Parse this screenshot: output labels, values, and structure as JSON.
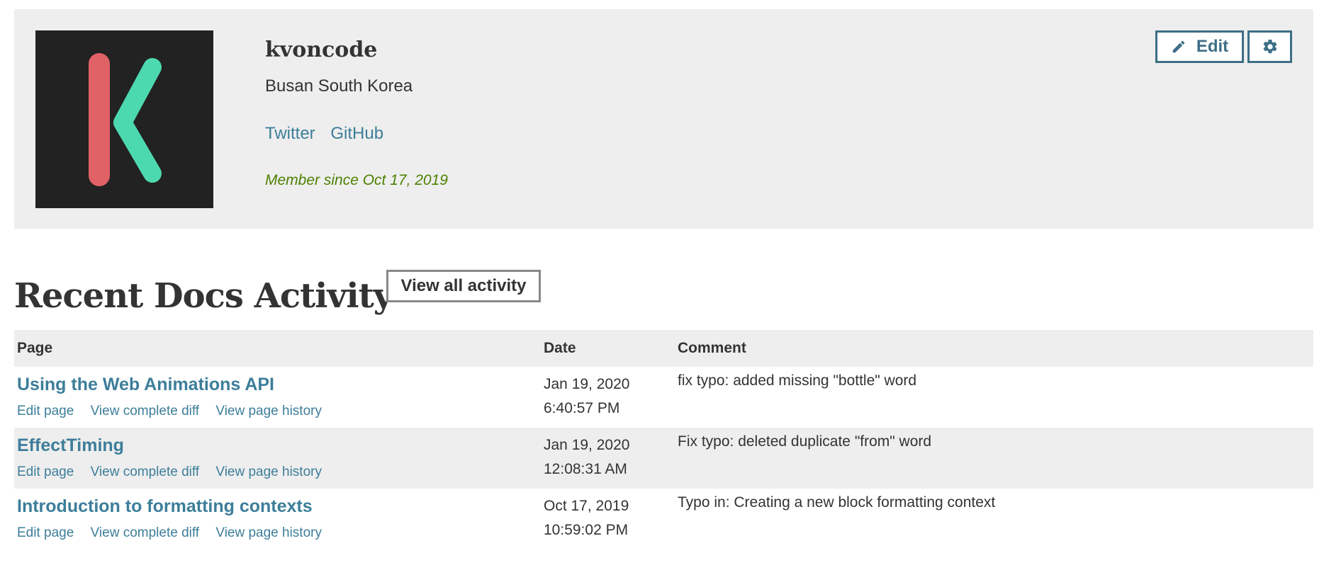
{
  "profile": {
    "username": "kvoncode",
    "location": "Busan South Korea",
    "links": [
      {
        "label": "Twitter"
      },
      {
        "label": "GitHub"
      }
    ],
    "member_since": "Member since Oct 17, 2019",
    "edit_label": "Edit",
    "icons": {
      "edit": "pencil-icon",
      "settings": "gear-icon"
    },
    "avatar_colors": {
      "background": "#222222",
      "left_stroke": "#e06166",
      "right_stroke": "#4dd9b0"
    }
  },
  "activity": {
    "heading": "Recent Docs Activity",
    "view_all_label": "View all activity",
    "columns": {
      "page": "Page",
      "date": "Date",
      "comment": "Comment"
    },
    "action_labels": {
      "edit": "Edit page",
      "diff": "View complete diff",
      "history": "View page history"
    },
    "rows": [
      {
        "title": "Using the Web Animations API",
        "date": "Jan 19, 2020",
        "time": "6:40:57 PM",
        "comment": "fix typo: added missing \"bottle\" word"
      },
      {
        "title": "EffectTiming",
        "date": "Jan 19, 2020",
        "time": "12:08:31 AM",
        "comment": "Fix typo: deleted duplicate \"from\" word"
      },
      {
        "title": "Introduction to formatting contexts",
        "date": "Oct 17, 2019",
        "time": "10:59:02 PM",
        "comment": "Typo in: Creating a new block formatting context"
      }
    ]
  },
  "colors": {
    "link": "#3d7e9a",
    "member_since": "#4d8102",
    "button_border": "#3d6e86",
    "panel_background": "#eeeeee"
  }
}
